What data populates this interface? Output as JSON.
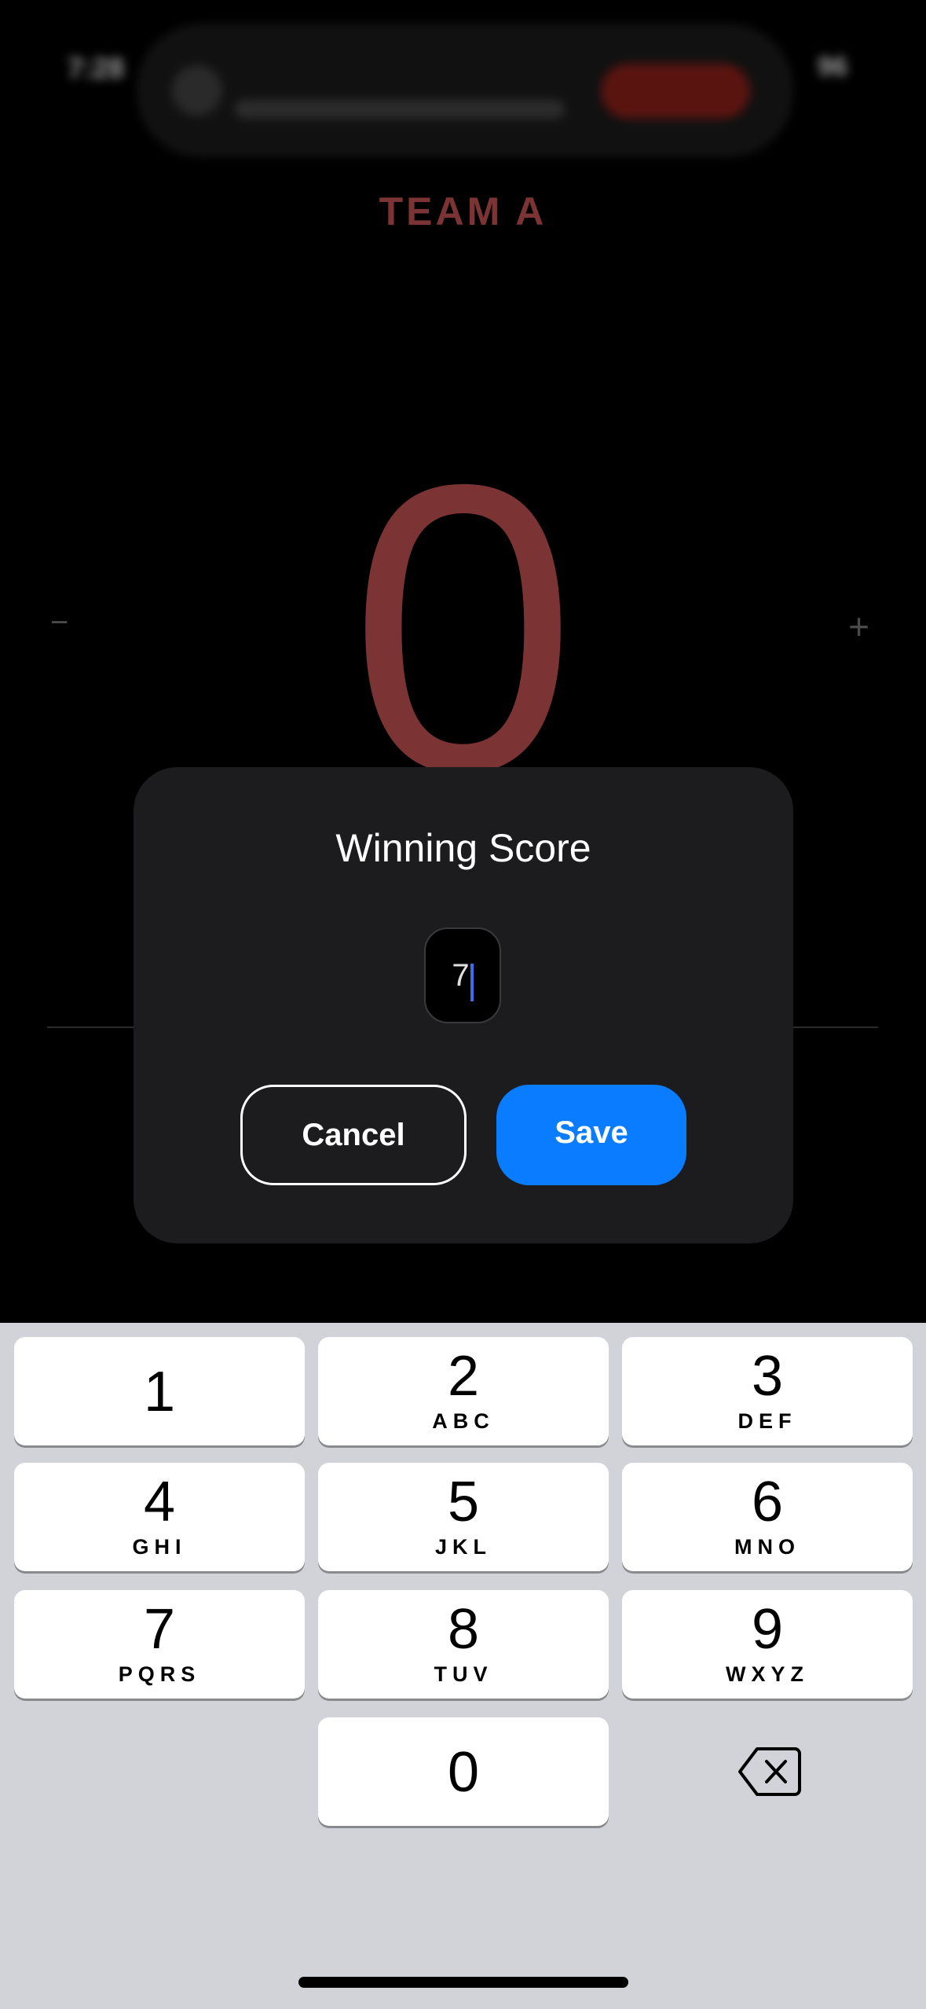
{
  "status_bar": {
    "time": "7:28",
    "battery": "96"
  },
  "team": {
    "name": "TEAM A",
    "score": "0",
    "minus_label": "−",
    "plus_label": "+"
  },
  "dialog": {
    "title": "Winning Score",
    "input_value": "7",
    "cancel_label": "Cancel",
    "save_label": "Save"
  },
  "keyboard": {
    "keys": [
      {
        "num": "1",
        "letters": ""
      },
      {
        "num": "2",
        "letters": "ABC"
      },
      {
        "num": "3",
        "letters": "DEF"
      },
      {
        "num": "4",
        "letters": "GHI"
      },
      {
        "num": "5",
        "letters": "JKL"
      },
      {
        "num": "6",
        "letters": "MNO"
      },
      {
        "num": "7",
        "letters": "PQRS"
      },
      {
        "num": "8",
        "letters": "TUV"
      },
      {
        "num": "9",
        "letters": "WXYZ"
      },
      {
        "num": "0",
        "letters": ""
      }
    ],
    "backspace_icon": "delete-left-icon"
  },
  "colors": {
    "team_red": "#7b3334",
    "save_blue": "#0a7cff",
    "dialog_bg": "#1c1c1e",
    "keyboard_bg": "#d1d3d9"
  }
}
